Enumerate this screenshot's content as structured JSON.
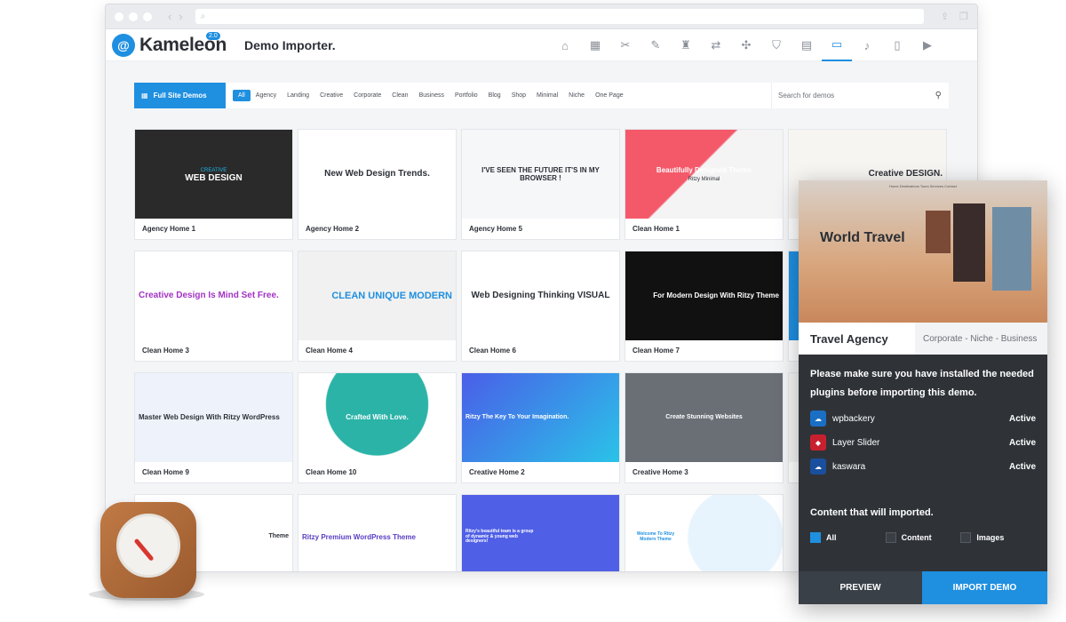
{
  "app": {
    "name": "Kameleon",
    "version": "2.0",
    "title": "Demo Importer."
  },
  "toolbar": {
    "icons": [
      "home-icon",
      "layout-icon",
      "tools-icon",
      "pen-icon",
      "brush-icon",
      "translate-icon",
      "puzzle-icon",
      "shield-icon",
      "card-icon",
      "devices-icon",
      "mic-icon",
      "mobile-icon",
      "video-icon"
    ]
  },
  "filter": {
    "full_site": "Full Site Demos",
    "categories": [
      "All",
      "Agency",
      "Landing",
      "Creative",
      "Corporate",
      "Clean",
      "Business",
      "Portfolio",
      "Blog",
      "Shop",
      "Minimal",
      "Niche",
      "One Page"
    ],
    "search_placeholder": "Search for demos"
  },
  "demos": [
    {
      "label": "Agency Home 1",
      "head": "WEB DESIGN",
      "sub": "CREATIVE",
      "bg": "#2a2a2a",
      "fg": "#ffffff"
    },
    {
      "label": "Agency Home 2",
      "head": "New Web Design Trends.",
      "sub": "",
      "bg": "#ffffff",
      "fg": "#2b2f36"
    },
    {
      "label": "Agency Home 5",
      "head": "I'VE SEEN THE FUTURE IT'S IN MY BROWSER !",
      "sub": "",
      "bg": "#f6f7f9",
      "fg": "#2b2f36"
    },
    {
      "label": "Clean Home 1",
      "head": "Beautifully Designed Theme",
      "sub": "Ritzy Minimal",
      "bg": "#f4f4f4",
      "fg": "#ffffff"
    },
    {
      "label": "",
      "head": "Creative DESIGN.",
      "sub": "",
      "bg": "#f7f5f2",
      "fg": "#2b2f36"
    },
    {
      "label": "Clean Home 3",
      "head": "Creative Design Is Mind Set Free.",
      "sub": "",
      "bg": "#ffffff",
      "fg": "#a232c4"
    },
    {
      "label": "Clean Home 4",
      "head": "CLEAN UNIQUE MODERN",
      "sub": "",
      "bg": "#f1f1f1",
      "fg": "#1f8fe0"
    },
    {
      "label": "Clean Home 6",
      "head": "Web Designing Thinking VISUAL",
      "sub": "",
      "bg": "#ffffff",
      "fg": "#2b2f36"
    },
    {
      "label": "Clean Home 7",
      "head": "For Modern Design With Ritzy Theme",
      "sub": "",
      "bg": "#111111",
      "fg": "#ffffff"
    },
    {
      "label": "",
      "head": "",
      "sub": "",
      "bg": "#1f8fe0",
      "fg": "#ffffff"
    },
    {
      "label": "Clean Home 9",
      "head": "Master Web Design With Ritzy WordPress",
      "sub": "",
      "bg": "#eef3fb",
      "fg": "#2b2f36"
    },
    {
      "label": "Clean Home 10",
      "head": "Crafted With Love.",
      "sub": "",
      "bg": "#2bb3a8",
      "fg": "#ffffff"
    },
    {
      "label": "Creative Home 2",
      "head": "Ritzy The Key To Your Imagination.",
      "sub": "",
      "bg": "#4a5ee8",
      "fg": "#ffffff"
    },
    {
      "label": "Creative Home 3",
      "head": "Create Stunning Websites",
      "sub": "",
      "bg": "#6a6f76",
      "fg": "#ffffff"
    },
    {
      "label": "",
      "head": "",
      "sub": "",
      "bg": "#f4f4f4",
      "fg": "#2b2f36"
    },
    {
      "label": "",
      "head": "Theme",
      "sub": "",
      "bg": "#ffffff",
      "fg": "#2b2f36"
    },
    {
      "label": "",
      "head": "Ritzy Premium WordPress Theme",
      "sub": "",
      "bg": "#ffffff",
      "fg": "#5a3cc4"
    },
    {
      "label": "",
      "head": "Ritzy's beautiful team is a group of dynamic & young web designers!",
      "sub": "",
      "bg": "#4f5fe6",
      "fg": "#ffffff"
    },
    {
      "label": "",
      "head": "Welcome To Ritzy Modern Theme",
      "sub": "",
      "bg": "#ffffff",
      "fg": "#1f8fe0"
    }
  ],
  "panel": {
    "hero_title": "World Travel",
    "hero_nav": "Home  Destinations  Tours  Services  Contact",
    "name": "Travel Agency",
    "tags": "Corporate - Niche - Business",
    "message": "Please make sure you have installed the needed plugins before importing this demo.",
    "plugins": [
      {
        "name": "wpbackery",
        "status": "Active",
        "color": "#1a6fc4",
        "icon": "wpbakery-icon"
      },
      {
        "name": "Layer Slider",
        "status": "Active",
        "color": "#c8202e",
        "icon": "layerslider-icon"
      },
      {
        "name": "kaswara",
        "status": "Active",
        "color": "#1a4f9e",
        "icon": "kaswara-icon"
      }
    ],
    "content_title": "Content that will imported.",
    "options": [
      {
        "label": "All",
        "checked": true
      },
      {
        "label": "Content",
        "checked": false
      },
      {
        "label": "Images",
        "checked": false
      }
    ],
    "preview_label": "PREVIEW",
    "import_label": "IMPORT DEMO"
  },
  "colors": {
    "accent": "#1f8fe0",
    "panel_bg": "#2f3338"
  }
}
